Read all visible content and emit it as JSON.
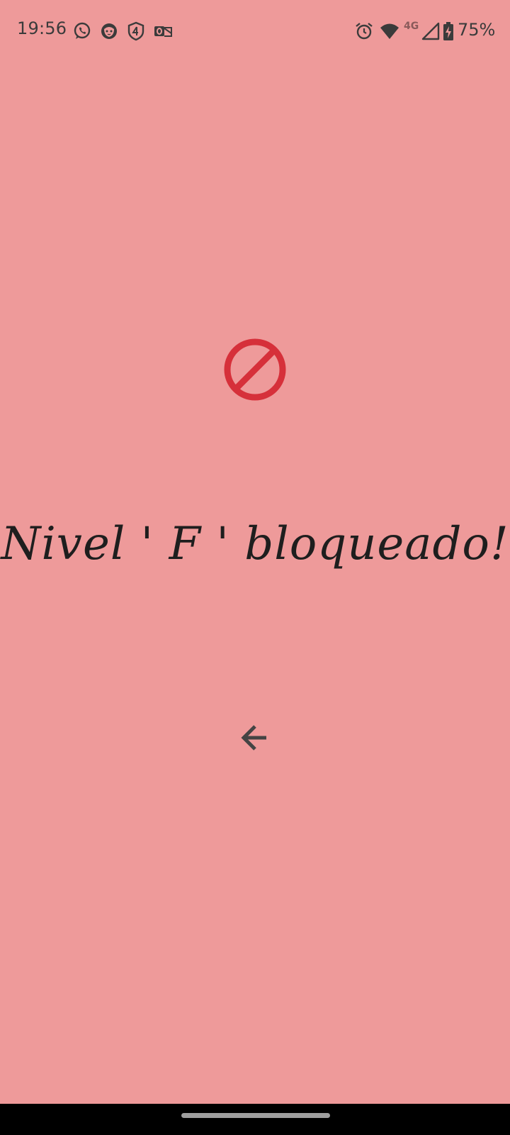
{
  "status_bar": {
    "time": "19:56",
    "network_label": "4G",
    "battery_percent": "75%",
    "notification_icons": [
      "whatsapp-icon",
      "cat-face-icon",
      "shield-4-icon",
      "outlook-icon"
    ],
    "system_icons": [
      "alarm-icon",
      "wifi-icon",
      "cellular-signal-icon",
      "battery-charging-icon"
    ]
  },
  "main": {
    "status_icon": "block-icon",
    "title": "Nivel ' F ' bloqueado!",
    "back_button_icon": "arrow-back-icon"
  },
  "colors": {
    "background": "#ee9a9a",
    "block_icon": "#d6303a",
    "title_text": "#1e1e1e",
    "back_arrow": "#444444",
    "nav_bar": "#000000",
    "home_indicator": "#9e9e9e"
  }
}
